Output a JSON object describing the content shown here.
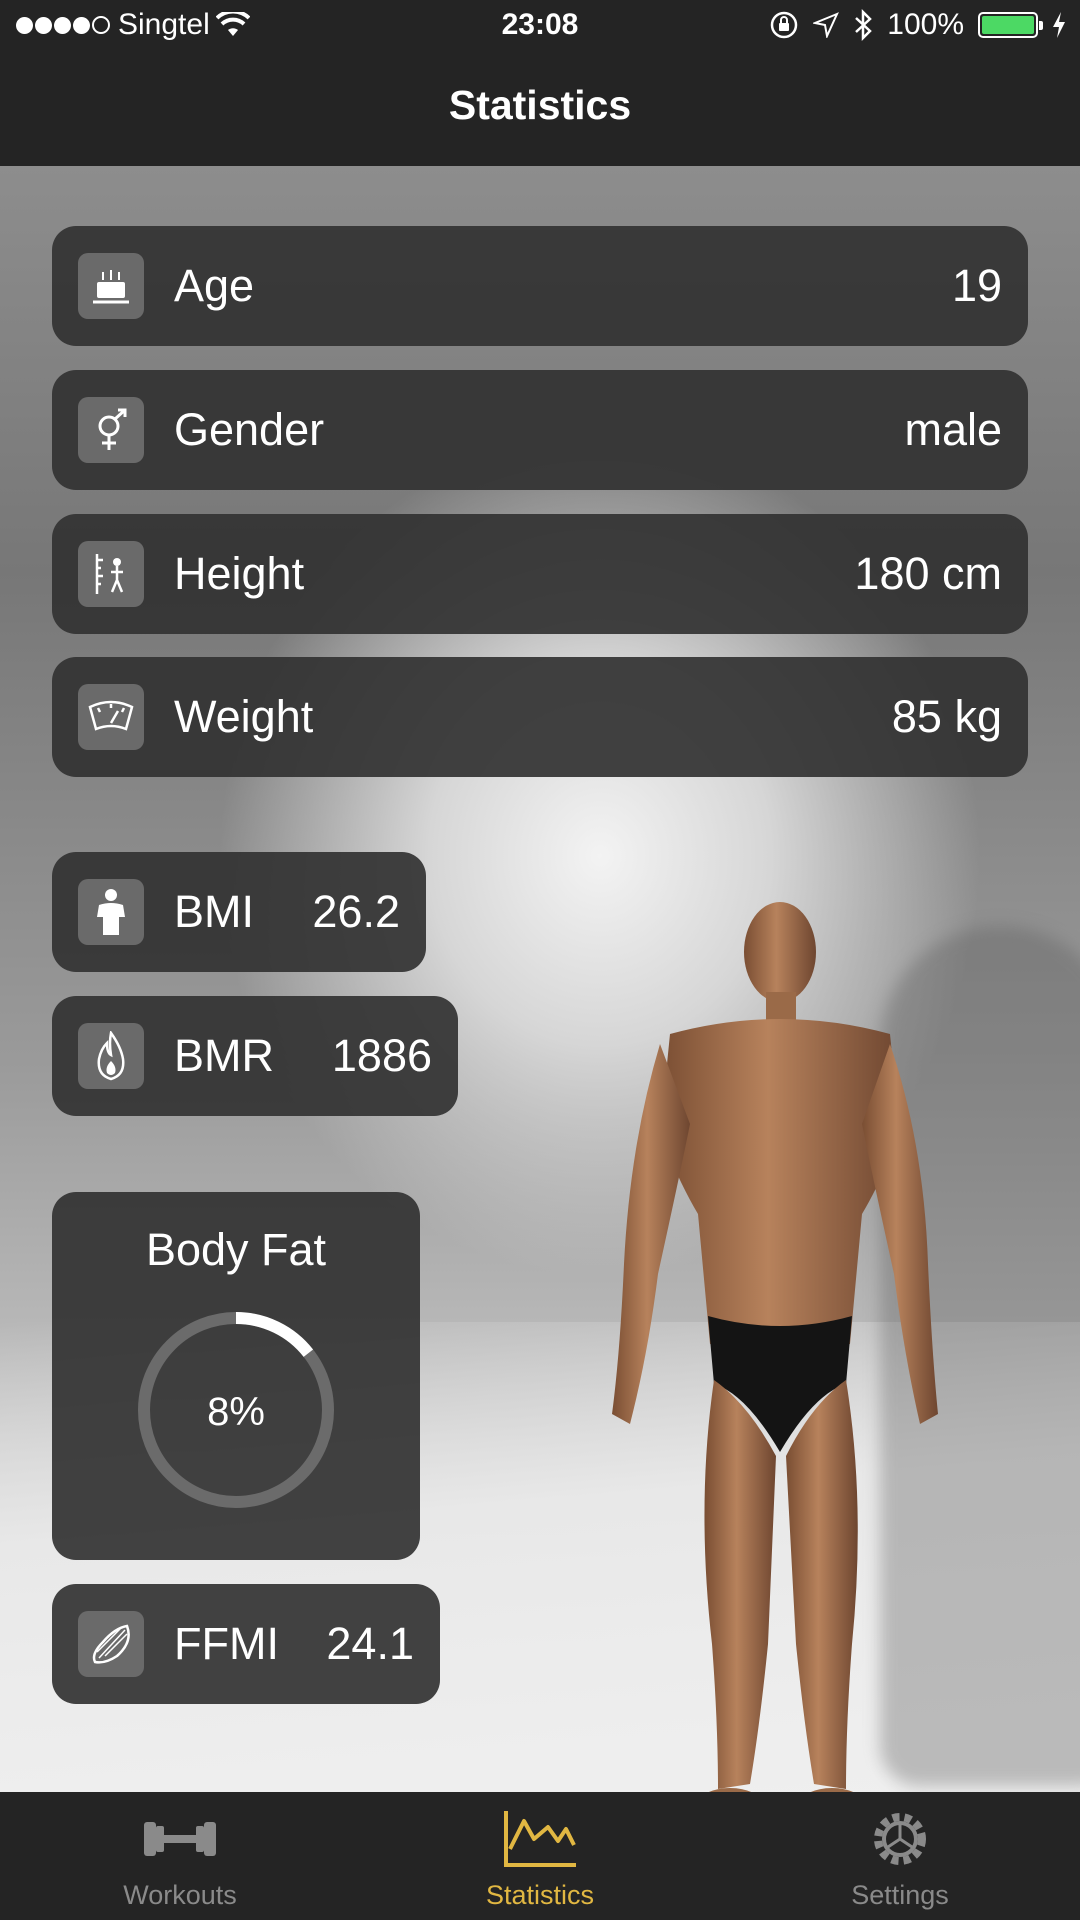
{
  "status_bar": {
    "carrier": "Singtel",
    "time": "23:08",
    "battery_percent": "100%",
    "battery_level": 1.0
  },
  "header": {
    "title": "Statistics"
  },
  "stats": {
    "age": {
      "label": "Age",
      "value": "19",
      "icon": "birthday-cake-icon"
    },
    "gender": {
      "label": "Gender",
      "value": "male",
      "icon": "gender-symbol-icon"
    },
    "height": {
      "label": "Height",
      "value": "180 cm",
      "icon": "height-measure-icon"
    },
    "weight": {
      "label": "Weight",
      "value": "85 kg",
      "icon": "scale-icon"
    }
  },
  "metrics": {
    "bmi": {
      "label": "BMI",
      "value": "26.2",
      "icon": "person-silhouette-icon"
    },
    "bmr": {
      "label": "BMR",
      "value": "1886",
      "icon": "flame-icon"
    },
    "ffmi": {
      "label": "FFMI",
      "value": "24.1",
      "icon": "muscle-icon"
    }
  },
  "body_fat": {
    "title": "Body Fat",
    "value": "8%",
    "fraction": 0.08
  },
  "tabs": [
    {
      "label": "Workouts",
      "icon": "dumbbell-icon",
      "active": false
    },
    {
      "label": "Statistics",
      "icon": "chart-icon",
      "active": true
    },
    {
      "label": "Settings",
      "icon": "gear-icon",
      "active": false
    }
  ],
  "colors": {
    "accent": "#e1b742",
    "card": "#323232",
    "bar": "#242424"
  }
}
